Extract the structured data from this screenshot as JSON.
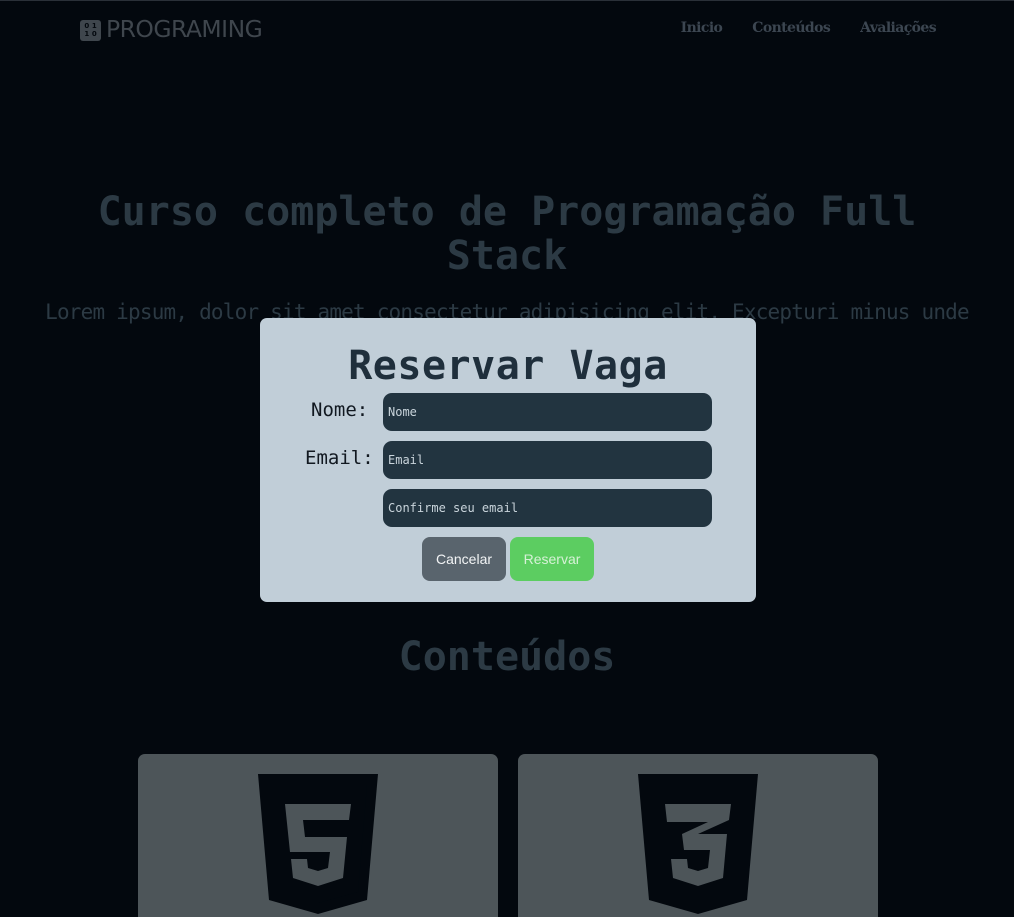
{
  "header": {
    "logo_icon_digits": [
      "0",
      "1",
      "1",
      "0"
    ],
    "logo_text": "PROGRAMING",
    "nav": [
      {
        "label": "Inicio"
      },
      {
        "label": "Conteúdos"
      },
      {
        "label": "Avaliações"
      }
    ]
  },
  "hero": {
    "title": "Curso completo de Programação Full Stack",
    "subtitle": "Lorem ipsum, dolor sit amet consectetur adipisicing elit. Excepturi minus unde"
  },
  "contents": {
    "title": "Conteúdos",
    "cards": [
      {
        "icon": "html5-icon",
        "digit": "5"
      },
      {
        "icon": "css3-icon",
        "digit": "3"
      }
    ]
  },
  "modal": {
    "title": "Reservar Vaga",
    "name_label": "Nome:",
    "email_label": "Email:",
    "name_placeholder": "Nome",
    "email_placeholder": "Email",
    "confirm_placeholder": "Confirme seu email",
    "cancel_label": "Cancelar",
    "reserve_label": "Reservar"
  },
  "colors": {
    "background": "#03080e",
    "modal_background": "#c1ced8",
    "input_background": "#223440",
    "cancel_button": "#59646d",
    "reserve_button": "#5ccd61",
    "card_background": "#4d5559"
  }
}
